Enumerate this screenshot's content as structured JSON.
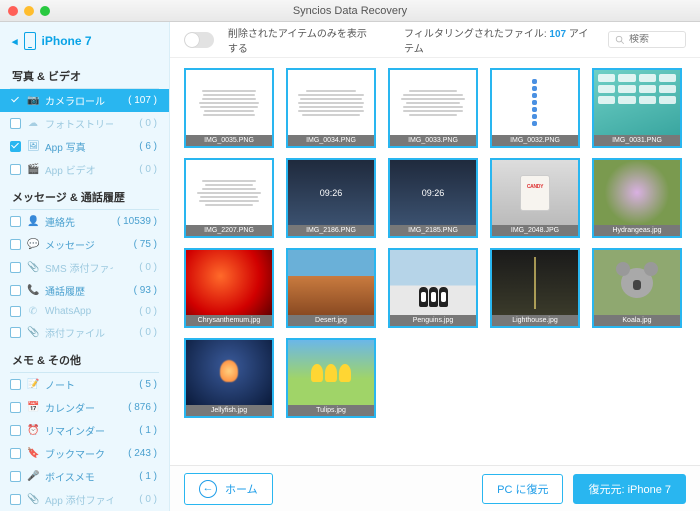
{
  "title": "Syncios Data Recovery",
  "device": "iPhone 7",
  "sections": [
    {
      "heading": "写真 & ビデオ",
      "items": [
        {
          "key": "cameraroll",
          "label": "カメラロール",
          "count": "( 107 )",
          "icon": "📷",
          "checked": true,
          "active": true,
          "dim": false
        },
        {
          "key": "photostream",
          "label": "フォトストリーム",
          "count": "( 0 )",
          "icon": "☁",
          "checked": false,
          "active": false,
          "dim": true
        },
        {
          "key": "appphotos",
          "label": "App 写真",
          "count": "( 6 )",
          "icon": "🖼",
          "checked": true,
          "active": false,
          "dim": false
        },
        {
          "key": "appvideos",
          "label": "App ビデオ",
          "count": "( 0 )",
          "icon": "🎬",
          "checked": false,
          "active": false,
          "dim": true
        }
      ]
    },
    {
      "heading": "メッセージ & 通話履歴",
      "items": [
        {
          "key": "contacts",
          "label": "連絡先",
          "count": "( 10539 )",
          "icon": "👤",
          "checked": false,
          "active": false,
          "dim": false
        },
        {
          "key": "messages",
          "label": "メッセージ",
          "count": "( 75 )",
          "icon": "💬",
          "checked": false,
          "active": false,
          "dim": false
        },
        {
          "key": "smsattach",
          "label": "SMS 添付ファイル",
          "count": "( 0 )",
          "icon": "📎",
          "checked": false,
          "active": false,
          "dim": true
        },
        {
          "key": "callhistory",
          "label": "通話履歴",
          "count": "( 93 )",
          "icon": "📞",
          "checked": false,
          "active": false,
          "dim": false
        },
        {
          "key": "whatsapp",
          "label": "WhatsApp",
          "count": "( 0 )",
          "icon": "✆",
          "checked": false,
          "active": false,
          "dim": true
        },
        {
          "key": "attach",
          "label": "添付ファイル",
          "count": "( 0 )",
          "icon": "📎",
          "checked": false,
          "active": false,
          "dim": true
        }
      ]
    },
    {
      "heading": "メモ & その他",
      "items": [
        {
          "key": "notes",
          "label": "ノート",
          "count": "( 5 )",
          "icon": "📝",
          "checked": false,
          "active": false,
          "dim": false
        },
        {
          "key": "calendar",
          "label": "カレンダー",
          "count": "( 876 )",
          "icon": "📅",
          "checked": false,
          "active": false,
          "dim": false
        },
        {
          "key": "reminders",
          "label": "リマインダー",
          "count": "( 1 )",
          "icon": "⏰",
          "checked": false,
          "active": false,
          "dim": false
        },
        {
          "key": "bookmarks",
          "label": "ブックマーク",
          "count": "( 243 )",
          "icon": "🔖",
          "checked": false,
          "active": false,
          "dim": false
        },
        {
          "key": "voicememo",
          "label": "ボイスメモ",
          "count": "( 1 )",
          "icon": "🎤",
          "checked": false,
          "active": false,
          "dim": false
        },
        {
          "key": "appattach",
          "label": "App 添付ファイル",
          "count": "( 0 )",
          "icon": "📎",
          "checked": false,
          "active": false,
          "dim": true
        }
      ]
    }
  ],
  "toolbar": {
    "deleted_only_label": "削除されたアイテムのみを表示する",
    "filtered_prefix": "フィルタリングされたファイル:",
    "filtered_count": "107",
    "filtered_suffix": "アイテム",
    "search_placeholder": "検索"
  },
  "thumbnails": [
    {
      "name": "IMG_0035.PNG",
      "art": "doc"
    },
    {
      "name": "IMG_0034.PNG",
      "art": "doc"
    },
    {
      "name": "IMG_0033.PNG",
      "art": "doc"
    },
    {
      "name": "IMG_0032.PNG",
      "art": "settings"
    },
    {
      "name": "IMG_0031.PNG",
      "art": "home"
    },
    {
      "name": "IMG_2207.PNG",
      "art": "doc"
    },
    {
      "name": "IMG_2186.PNG",
      "art": "sky",
      "text": "09:26"
    },
    {
      "name": "IMG_2185.PNG",
      "art": "sky",
      "text": "09:26"
    },
    {
      "name": "IMG_2048.JPG",
      "art": "candy"
    },
    {
      "name": "Hydrangeas.jpg",
      "art": "flower"
    },
    {
      "name": "Chrysanthemum.jpg",
      "art": "red"
    },
    {
      "name": "Desert.jpg",
      "art": "desert"
    },
    {
      "name": "Penguins.jpg",
      "art": "penguin"
    },
    {
      "name": "Lighthouse.jpg",
      "art": "light"
    },
    {
      "name": "Koala.jpg",
      "art": "koala"
    },
    {
      "name": "Jellyfish.jpg",
      "art": "jelly"
    },
    {
      "name": "Tulips.jpg",
      "art": "tulip"
    }
  ],
  "footer": {
    "home": "ホーム",
    "recover_pc": "PC に復元",
    "recover_device": "復元元: iPhone 7"
  }
}
